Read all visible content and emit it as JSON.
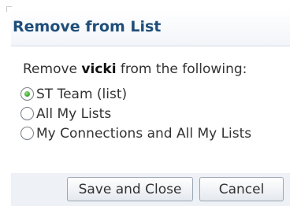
{
  "dialog": {
    "title": "Remove from List",
    "prompt": {
      "before": "Remove ",
      "user": "vicki",
      "after": " from the following:"
    },
    "options": [
      {
        "label": "ST Team (list)",
        "checked": true
      },
      {
        "label": "All My Lists",
        "checked": false
      },
      {
        "label": "My Connections and All My Lists",
        "checked": false
      }
    ],
    "buttons": {
      "save": "Save and Close",
      "cancel": "Cancel"
    }
  },
  "colors": {
    "title": "#1f4e7a",
    "radio_selected": "#3aa22a",
    "button_bar": "#eef1f5"
  }
}
